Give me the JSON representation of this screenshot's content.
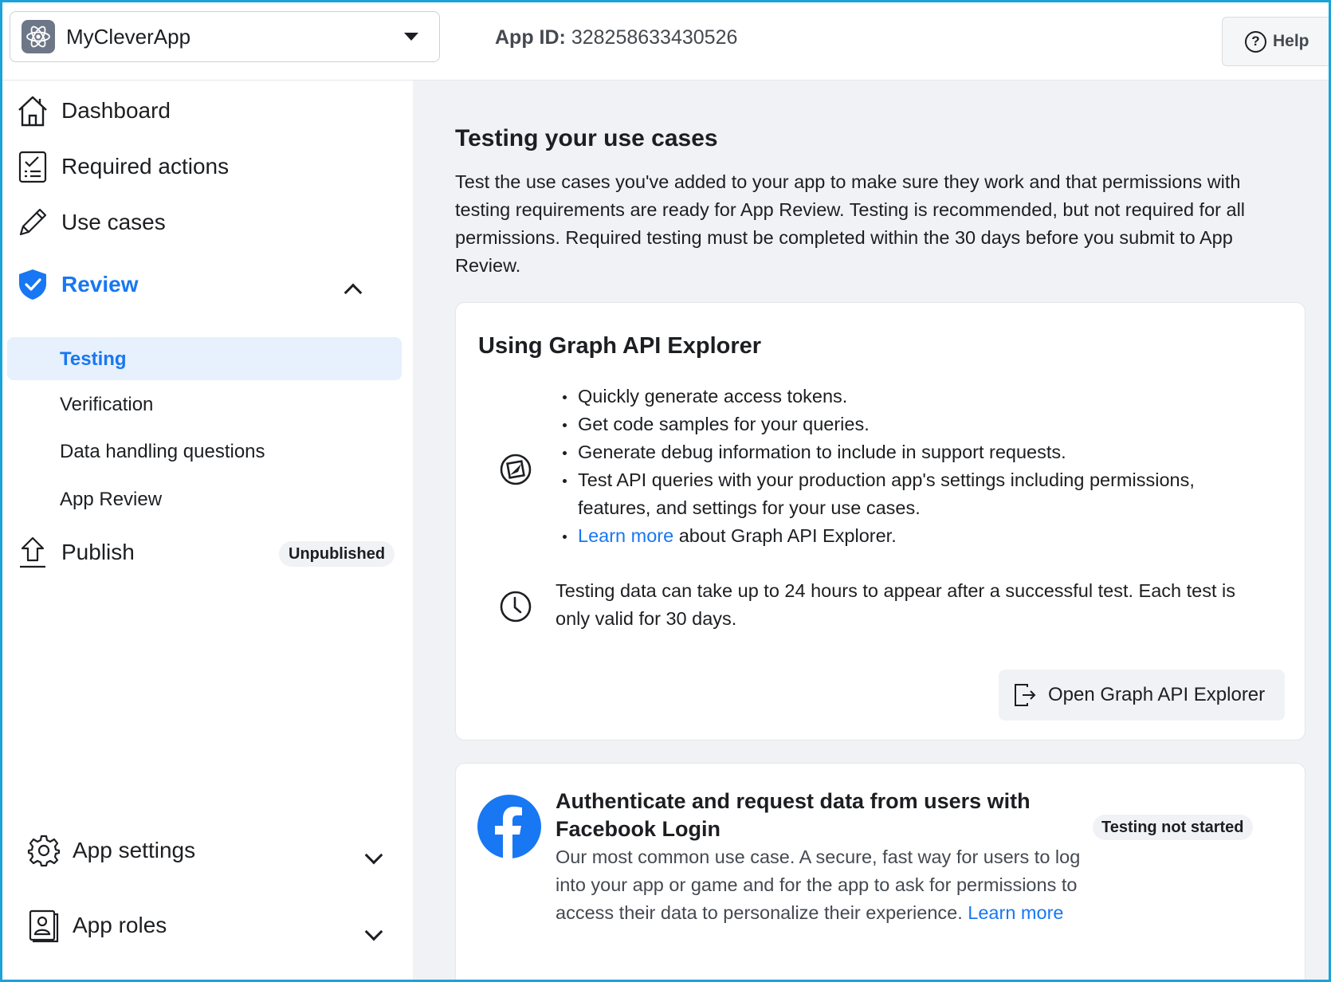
{
  "header": {
    "app_name": "MyCleverApp",
    "app_id_label": "App ID:",
    "app_id_value": "328258633430526",
    "help_label": "Help"
  },
  "sidebar": {
    "dashboard": "Dashboard",
    "required_actions": "Required actions",
    "use_cases": "Use cases",
    "review": "Review",
    "review_sub": [
      "Testing",
      "Verification",
      "Data handling questions",
      "App Review"
    ],
    "publish": "Publish",
    "publish_badge": "Unpublished",
    "app_settings": "App settings",
    "app_roles": "App roles"
  },
  "main": {
    "title": "Testing your use cases",
    "description": "Test the use cases you've added to your app to make sure they work and that permissions with testing requirements are ready for App Review. Testing is recommended, but not required for all permissions. Required testing must be completed within the 30 days before you submit to App Review.",
    "graph_card": {
      "title": "Using Graph API Explorer",
      "bullets": [
        "Quickly generate access tokens.",
        "Get code samples for your queries.",
        "Generate debug information to include in support requests.",
        "Test API queries with your production app's settings including permissions, features, and settings for your use cases."
      ],
      "learn_more_link": "Learn more",
      "learn_more_rest": " about Graph API Explorer.",
      "note": "Testing data can take up to 24 hours to appear after a successful test. Each test is only valid for 30 days.",
      "button_label": "Open Graph API Explorer"
    },
    "fb_card": {
      "title": "Authenticate and request data from users with Facebook Login",
      "description": "Our most common use case. A secure, fast way for users to log into your app or game and for the app to ask for permissions to access their data to personalize their experience. ",
      "learn_more_link": "Learn more",
      "status": "Testing not started"
    }
  },
  "colors": {
    "accent": "#1877f2",
    "active_bg": "#e7f0fd",
    "main_bg": "#f0f2f5",
    "frame_border": "#1aa3d9"
  }
}
